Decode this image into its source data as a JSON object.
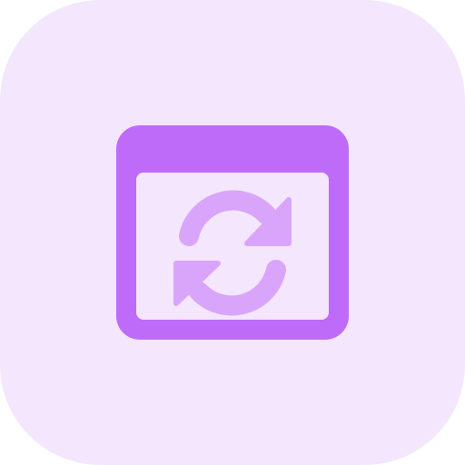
{
  "icon": {
    "name": "browser-refresh-icon",
    "colors": {
      "background": "#F3E6FD",
      "window": "#BE6BFA",
      "window_inner": "#F3E6FD",
      "arrows": "#D9A5FB"
    }
  }
}
